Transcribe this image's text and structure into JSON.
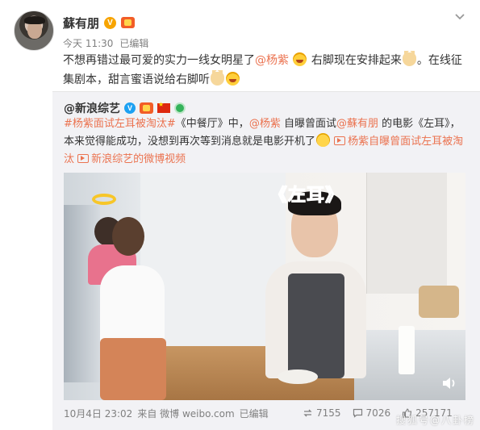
{
  "post": {
    "author_name": "蘇有朋",
    "badge_v": "V",
    "time": "今天 11:30",
    "edited": "已编辑",
    "text_1": "不想再错过最可爱的实力一线女明星了",
    "mention_1": "@杨紫",
    "text_2": "右脚现在安排起来",
    "text_3": "。在线征集剧本，甜言蜜语说给右脚听"
  },
  "repost": {
    "author": "@新浪综艺",
    "badge_v": "V",
    "topic_1": "#杨紫面试左耳被淘汰#",
    "text_1": "《中餐厅》中，",
    "mention_1": "@杨紫",
    "text_2": " 自曝曾面试",
    "mention_2": "@蘇有朋",
    "text_3": " 的电影《左耳》，本来觉得能成功，没想到再次等到消息就是电影开机了",
    "video_link": "杨紫自曝曾面试左耳被淘汰",
    "sina_link": "新浪综艺的微博视频",
    "video_caption": "《左耳》",
    "date": "10月4日 23:02",
    "source": "来自 微博 weibo.com",
    "edited": "已编辑",
    "reposts": "7155",
    "comments": "7026",
    "likes": "257171"
  },
  "icons": {
    "menu": "chevron-down-icon",
    "repost": "repost-icon",
    "comment": "comment-icon",
    "like": "like-icon",
    "sound": "speaker-icon"
  },
  "colors": {
    "link": "#eb7350",
    "meta": "#808080",
    "repost_bg": "#f2f2f5"
  },
  "watermark": "搜狐号@八卦榜"
}
